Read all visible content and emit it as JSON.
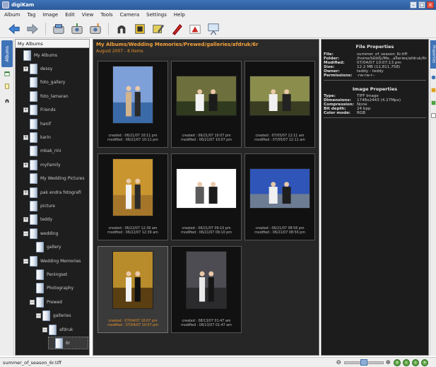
{
  "window": {
    "title": "digiKam"
  },
  "menu": [
    "Album",
    "Tag",
    "Image",
    "Edit",
    "View",
    "Tools",
    "Camera",
    "Settings",
    "Help"
  ],
  "left_tabs": {
    "albums": "Albums"
  },
  "right_tabs": {
    "properties": "Properties"
  },
  "album_panel": {
    "header": "My Albums",
    "items": [
      {
        "label": "My Albums",
        "level": 0,
        "expand": ""
      },
      {
        "label": "dessy",
        "level": 1,
        "expand": "+"
      },
      {
        "label": "foto_gallery",
        "level": 1,
        "expand": ""
      },
      {
        "label": "foto_lamaran",
        "level": 1,
        "expand": ""
      },
      {
        "label": "Friends",
        "level": 1,
        "expand": "+"
      },
      {
        "label": "hanif",
        "level": 1,
        "expand": ""
      },
      {
        "label": "karin",
        "level": 1,
        "expand": "+"
      },
      {
        "label": "mbak_rini",
        "level": 1,
        "expand": ""
      },
      {
        "label": "myFamily",
        "level": 1,
        "expand": "+"
      },
      {
        "label": "My Wedding Pictures",
        "level": 1,
        "expand": ""
      },
      {
        "label": "pak endra fotografi",
        "level": 1,
        "expand": "+"
      },
      {
        "label": "picture",
        "level": 1,
        "expand": ""
      },
      {
        "label": "teddy",
        "level": 1,
        "expand": "+"
      },
      {
        "label": "wedding",
        "level": 1,
        "expand": "−"
      },
      {
        "label": "gallery",
        "level": 2,
        "expand": ""
      },
      {
        "label": "Wedding Memories",
        "level": 1,
        "expand": "−"
      },
      {
        "label": "Peningset",
        "level": 2,
        "expand": ""
      },
      {
        "label": "Photography",
        "level": 2,
        "expand": ""
      },
      {
        "label": "Prewed",
        "level": 2,
        "expand": "−"
      },
      {
        "label": "galleries",
        "level": 3,
        "expand": "−"
      },
      {
        "label": "afdruk",
        "level": 4,
        "expand": "−"
      },
      {
        "label": "6r",
        "level": 5,
        "expand": "",
        "selected": true
      }
    ]
  },
  "main": {
    "title": "My Albums/Wedding Memories/Prewed/galleries/afdruk/6r",
    "subtitle": "August 2007 - 8 Items",
    "thumbnails": [
      {
        "created": "created : 06/21/07 10:11 pm",
        "modified": "modified : 06/21/07 10:11 pm",
        "orientation": "portrait",
        "palette": [
          "#7ea0d8",
          "#3b6aa8",
          "#d2b48c",
          "#2a2a2a"
        ]
      },
      {
        "created": "created : 06/21/07 10:07 pm",
        "modified": "modified : 06/21/07 10:07 pm",
        "orientation": "landscape",
        "palette": [
          "#6d6f3c",
          "#2f3a1e",
          "#f2f2f2",
          "#1b1b1b"
        ]
      },
      {
        "created": "created : 07/05/07 12:11 am",
        "modified": "modified : 07/05/07 12:11 am",
        "orientation": "landscape",
        "palette": [
          "#8a8d4c",
          "#3a3d22",
          "#f0f0f0",
          "#222"
        ]
      },
      {
        "created": "created : 06/22/07 12:39 am",
        "modified": "modified : 06/22/07 12:39 am",
        "orientation": "portrait",
        "palette": [
          "#c9952f",
          "#a5762a",
          "#f3f3f3",
          "#2a2a2a"
        ]
      },
      {
        "created": "created : 06/21/07 09:10 pm",
        "modified": "modified : 06/21/07 09:10 pm",
        "orientation": "landscape",
        "palette": [
          "#ffffff",
          "#ffffff",
          "#5a5a5a",
          "#1b1b1b"
        ]
      },
      {
        "created": "created : 06/21/07 08:56 pm",
        "modified": "modified : 06/21/07 08:56 pm",
        "orientation": "landscape",
        "palette": [
          "#2f55b9",
          "#6c7c93",
          "#f0f0f0",
          "#1f1f1f"
        ]
      },
      {
        "created": "created : 07/04/07 10:07 pm",
        "modified": "modified : 07/04/07 10:07 pm",
        "orientation": "portrait",
        "palette": [
          "#b98c2b",
          "#5a3f12",
          "#f1f1f1",
          "#111"
        ],
        "selected": true
      },
      {
        "created": "created : 08/13/07 01:47 am",
        "modified": "modified : 08/13/07 01:47 am",
        "orientation": "portrait",
        "palette": [
          "#4d4c52",
          "#2b2b2e",
          "#e9e9e9",
          "#151515"
        ]
      }
    ]
  },
  "properties": {
    "file_header": "File Properties",
    "file": [
      {
        "k": "File:",
        "v": "summer_of_season_6r.tiff"
      },
      {
        "k": "Folder:",
        "v": "/home/teddy/Me...alleries/afdruk/6r"
      },
      {
        "k": "Modified:",
        "v": "07/04/07 10:07:13 pm"
      },
      {
        "k": "Size:",
        "v": "12.2 MB (12,811,758)"
      },
      {
        "k": "Owner:",
        "v": "teddy - teddy"
      },
      {
        "k": "Permissions:",
        "v": "-rw-rw-r--"
      }
    ],
    "image_header": "Image Properties",
    "image": [
      {
        "k": "Type:",
        "v": "TIFF Image"
      },
      {
        "k": "Dimensions:",
        "v": "1748x2443 (4.27Mpx)"
      },
      {
        "k": "Compression:",
        "v": "None"
      },
      {
        "k": "Bit depth:",
        "v": "24 bpp"
      },
      {
        "k": "Color mode:",
        "v": "RGB"
      }
    ]
  },
  "status": {
    "text": "summer_of_season_6r.tiff",
    "zoom_level": 0.5
  }
}
